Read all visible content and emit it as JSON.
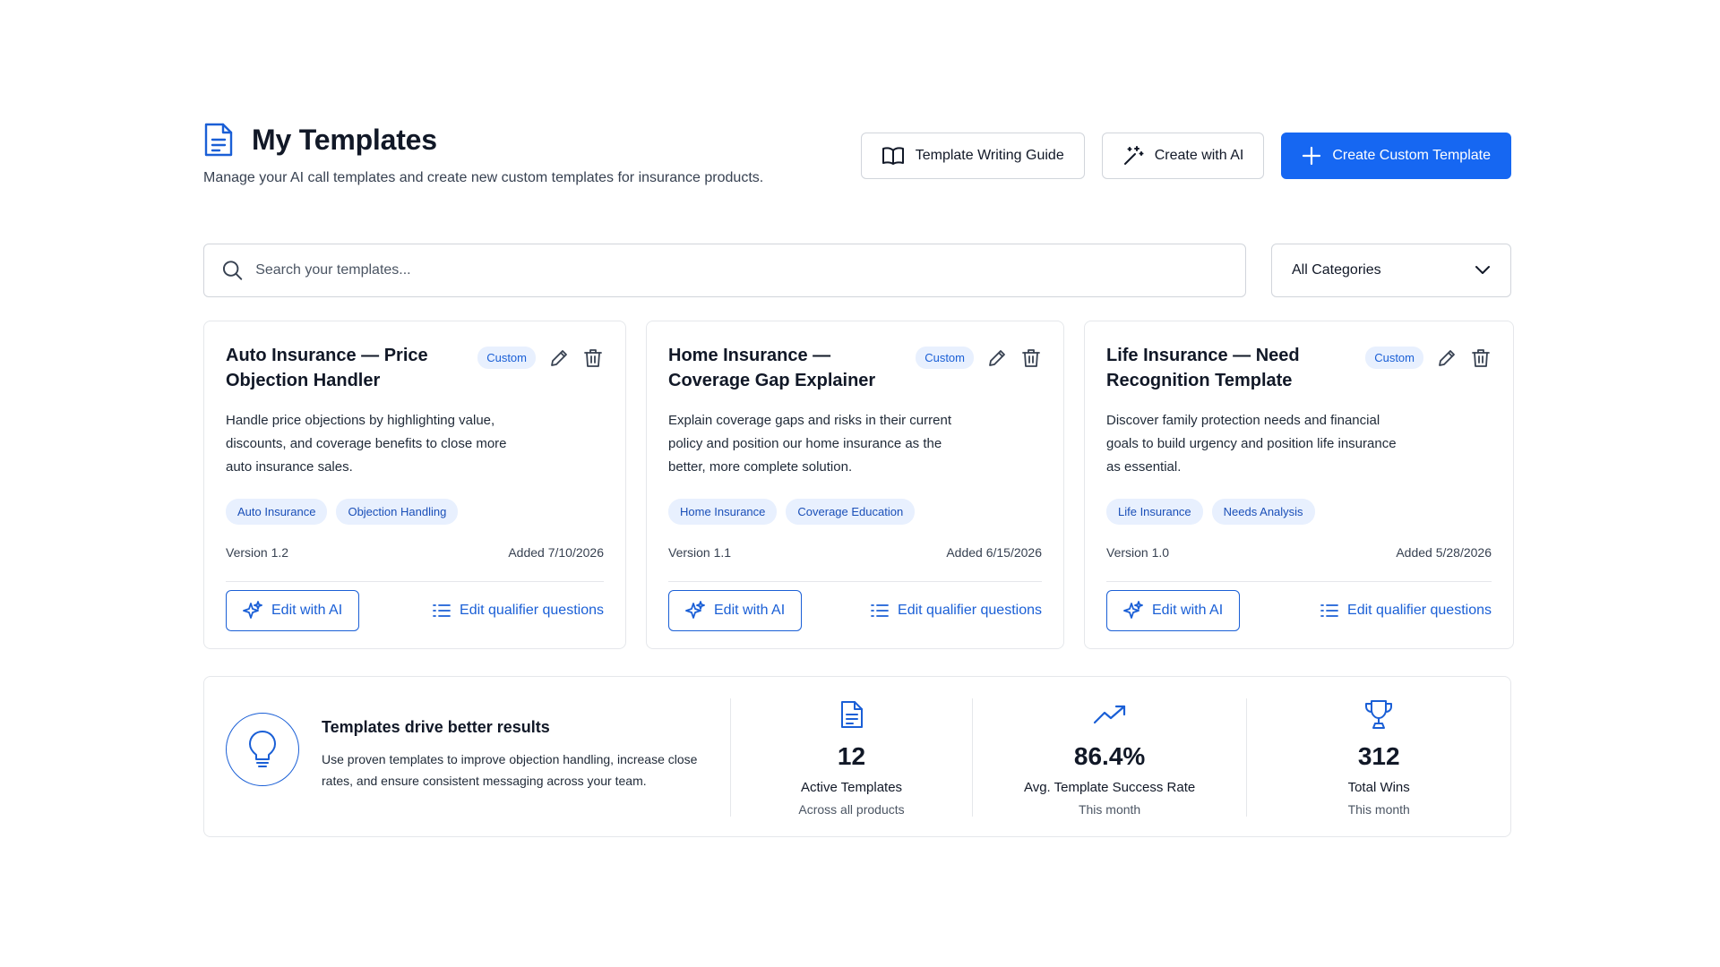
{
  "header": {
    "title": "My Templates",
    "subtitle": "Manage your AI call templates and create new custom templates for insurance products.",
    "buttons": {
      "guide": "Template Writing Guide",
      "create_ai": "Create with AI",
      "create_custom": "Create Custom Template"
    }
  },
  "search": {
    "placeholder": "Search your templates...",
    "value": ""
  },
  "category_filter": {
    "selected": "All Categories"
  },
  "colors": {
    "accent": "#1667f2",
    "link": "#1a5fd6",
    "badge_bg": "#e8f0fe"
  },
  "cards": [
    {
      "title": "Auto Insurance — Price Objection Handler",
      "badge": "Custom",
      "description": "Handle price objections by highlighting value, discounts, and coverage benefits to close more auto insurance sales.",
      "tags": [
        "Auto Insurance",
        "Objection Handling"
      ],
      "version": "Version 1.2",
      "added": "Added 7/10/2026",
      "edit_ai_label": "Edit with AI",
      "qualifier_label": "Edit qualifier questions"
    },
    {
      "title": "Home Insurance — Coverage Gap Explainer",
      "badge": "Custom",
      "description": "Explain coverage gaps and risks in their current policy and position our home insurance as the better, more complete solution.",
      "tags": [
        "Home Insurance",
        "Coverage Education"
      ],
      "version": "Version 1.1",
      "added": "Added 6/15/2026",
      "edit_ai_label": "Edit with AI",
      "qualifier_label": "Edit qualifier questions"
    },
    {
      "title": "Life Insurance — Need Recognition Template",
      "badge": "Custom",
      "description": "Discover family protection needs and financial goals to build urgency and position life insurance as essential.",
      "tags": [
        "Life Insurance",
        "Needs Analysis"
      ],
      "version": "Version 1.0",
      "added": "Added 5/28/2026",
      "edit_ai_label": "Edit with AI",
      "qualifier_label": "Edit qualifier questions"
    }
  ],
  "promo": {
    "title": "Templates drive better results",
    "text": "Use proven templates to improve objection handling, increase close rates, and ensure consistent messaging across your team."
  },
  "stats": [
    {
      "icon": "document-icon",
      "value": "12",
      "label": "Active Templates",
      "sub": "Across all products"
    },
    {
      "icon": "trending-up-icon",
      "value": "86.4%",
      "label": "Avg. Template Success Rate",
      "sub": "This month"
    },
    {
      "icon": "trophy-icon",
      "value": "312",
      "label": "Total Wins",
      "sub": "This month"
    }
  ]
}
